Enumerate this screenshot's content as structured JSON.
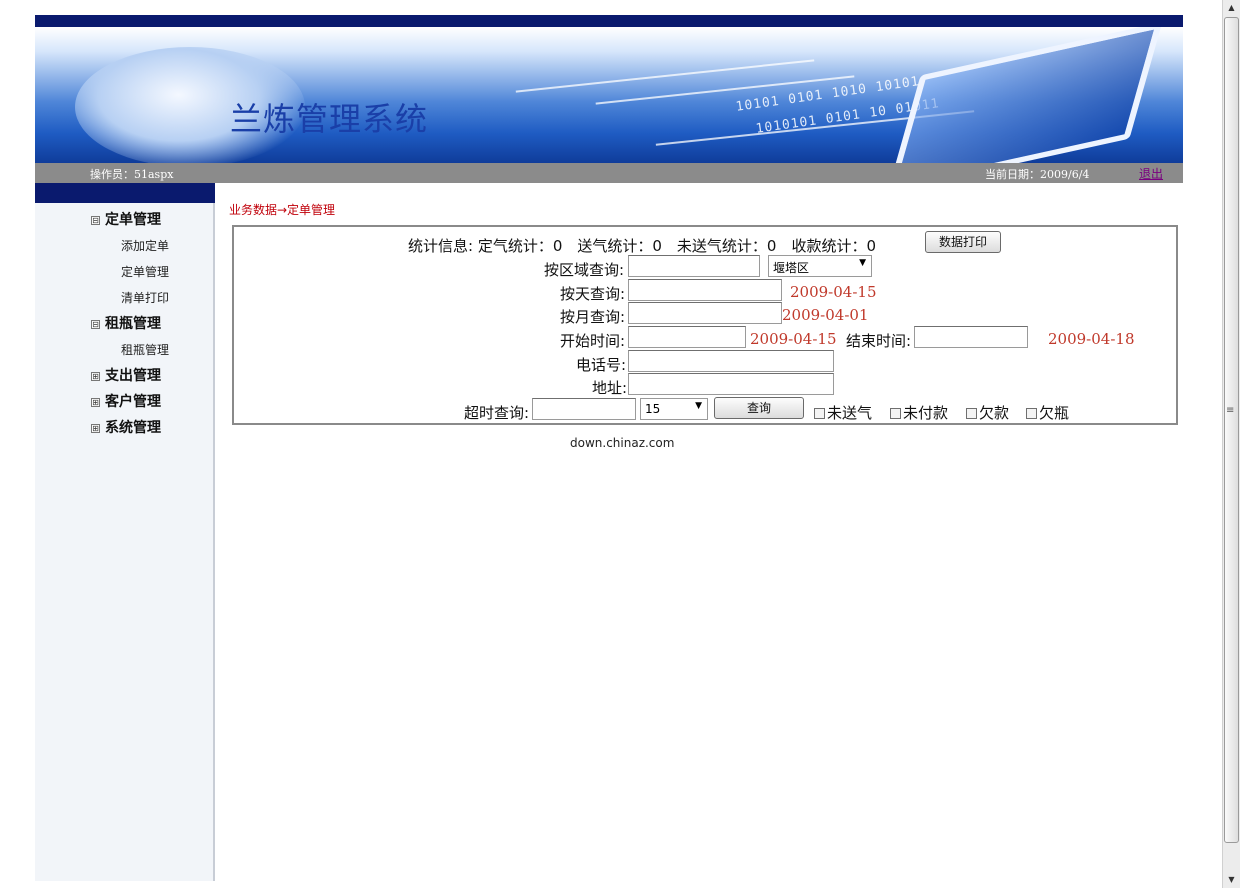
{
  "header": {
    "system_title": "兰炼管理系统",
    "operator": "操作员：51aspx",
    "current_date": "当前日期：2009/6/4",
    "logout": "退出"
  },
  "sidebar": {
    "groups": [
      {
        "label": "定单管理",
        "expanded": true,
        "items": [
          "添加定单",
          "定单管理",
          "清单打印"
        ]
      },
      {
        "label": "租瓶管理",
        "expanded": true,
        "items": [
          "租瓶管理"
        ]
      },
      {
        "label": "支出管理",
        "expanded": false,
        "items": []
      },
      {
        "label": "客户管理",
        "expanded": false,
        "items": []
      },
      {
        "label": "系统管理",
        "expanded": false,
        "items": []
      }
    ],
    "expanded_glyph": "⊟",
    "collapsed_glyph": "⊞"
  },
  "breadcrumb": "业务数据→定单管理",
  "stats": {
    "text": "统计信息: 定气统计：0　送气统计：0　未送气统计：0　收款统计：0",
    "print_button": "数据打印"
  },
  "query": {
    "region_label": "按区域查询:",
    "region_value": "",
    "region_select": "堰塔区",
    "day_label": "按天查询:",
    "day_hint": "2009-04-15",
    "month_label": "按月查询:",
    "month_hint": "2009-04-01",
    "start_label": "开始时间:",
    "start_hint": "2009-04-15",
    "end_label": "结束时间:",
    "end_hint": "2009-04-18",
    "phone_label": "电话号:",
    "address_label": "地址:",
    "timeout_label": "超时查询:",
    "timeout_select": "15",
    "query_button": "查询",
    "checkboxes": [
      "未送气",
      "未付款",
      "欠款",
      "欠瓶"
    ]
  },
  "footer": "down.chinaz.com",
  "colors": {
    "nav_dark": "#0a1a6e",
    "accent_red": "#c0392b",
    "sidebar_bg": "#f2f5f9"
  }
}
